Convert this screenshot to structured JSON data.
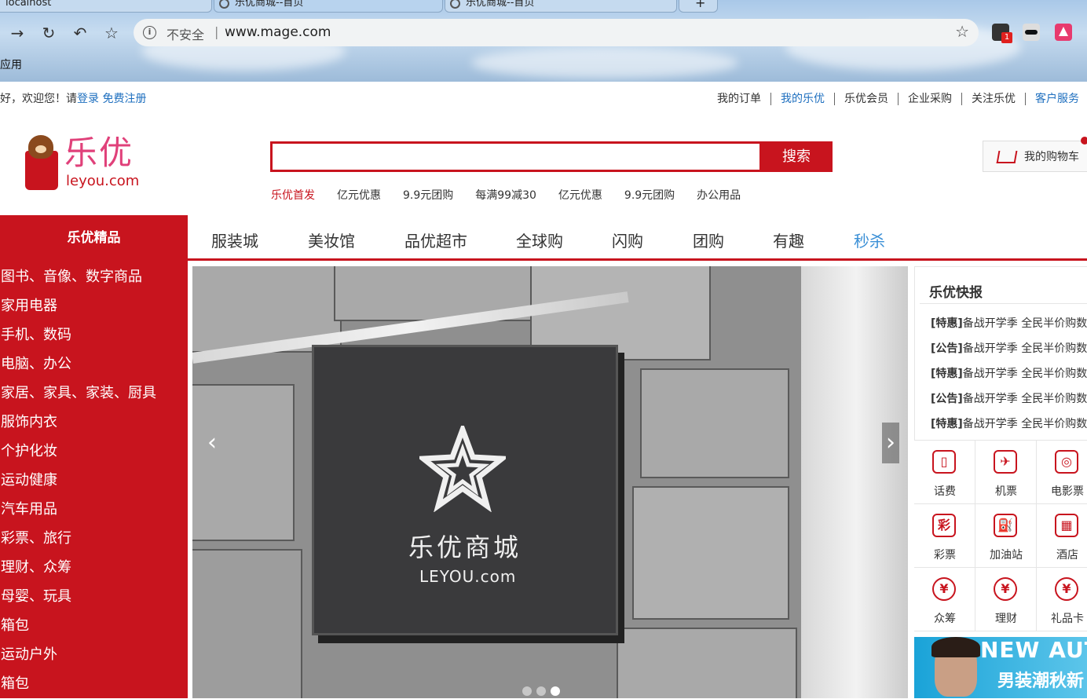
{
  "browser": {
    "tabs": [
      "localhost",
      "乐优商城--首页",
      "乐优商城--首页"
    ],
    "new_tab": "+",
    "insecure_label": "不安全",
    "separator": "|",
    "url": "www.mage.com",
    "bookmark_apps": "应用",
    "ext_badge": "1"
  },
  "topbar": {
    "welcome": "您好，欢迎您！请",
    "login": "登录",
    "register": "免费注册",
    "links": [
      "我的订单",
      "我的乐优",
      "乐优会员",
      "企业采购",
      "关注乐优",
      "客户服务"
    ]
  },
  "logo": {
    "cn": "乐优",
    "en": "leyou.com"
  },
  "search": {
    "button": "搜索",
    "hotwords": [
      "乐优首发",
      "亿元优惠",
      "9.9元团购",
      "每满99减30",
      "亿元优惠",
      "9.9元团购",
      "办公用品"
    ]
  },
  "cart": {
    "label": "我的购物车"
  },
  "nav": {
    "category_head": "乐优精品",
    "items": [
      "服装城",
      "美妆馆",
      "品优超市",
      "全球购",
      "闪购",
      "团购",
      "有趣",
      "秒杀"
    ]
  },
  "categories": [
    "图书、音像、数字商品",
    "家用电器",
    "手机、数码",
    "电脑、办公",
    "家居、家具、家装、厨具",
    "服饰内衣",
    "个护化妆",
    "运动健康",
    "汽车用品",
    "彩票、旅行",
    "理财、众筹",
    "母婴、玩具",
    "箱包",
    "运动户外",
    "箱包"
  ],
  "banner": {
    "sign_cn": "乐优商城",
    "sign_en": "LEYOU.com",
    "prev": "‹",
    "next": "›"
  },
  "news": {
    "title": "乐优快报",
    "items": [
      {
        "tag": "[特惠]",
        "text": "备战开学季 全民半价购数码"
      },
      {
        "tag": "[公告]",
        "text": "备战开学季 全民半价购数码"
      },
      {
        "tag": "[特惠]",
        "text": "备战开学季 全民半价购数码"
      },
      {
        "tag": "[公告]",
        "text": "备战开学季 全民半价购数码"
      },
      {
        "tag": "[特惠]",
        "text": "备战开学季 全民半价购数码"
      }
    ]
  },
  "services": [
    {
      "label": "话费",
      "icon": "phone-icon",
      "glyph": "▯"
    },
    {
      "label": "机票",
      "icon": "plane-icon",
      "glyph": "✈"
    },
    {
      "label": "电影票",
      "icon": "film-icon",
      "glyph": "◎"
    },
    {
      "label": "彩票",
      "icon": "lottery-icon",
      "glyph": "彩"
    },
    {
      "label": "加油站",
      "icon": "gas-station-icon",
      "glyph": "⛽"
    },
    {
      "label": "酒店",
      "icon": "hotel-icon",
      "glyph": "▦"
    },
    {
      "label": "众筹",
      "icon": "crowdfunding-icon",
      "glyph": "¥"
    },
    {
      "label": "理财",
      "icon": "finance-icon",
      "glyph": "¥"
    },
    {
      "label": "礼品卡",
      "icon": "gift-card-icon",
      "glyph": "¥"
    }
  ],
  "ad": {
    "line1": "NEW AUTUMN",
    "line2": "男装潮秋新"
  },
  "colors": {
    "brand_red": "#c8141e",
    "link_blue": "#1e6fbf"
  }
}
